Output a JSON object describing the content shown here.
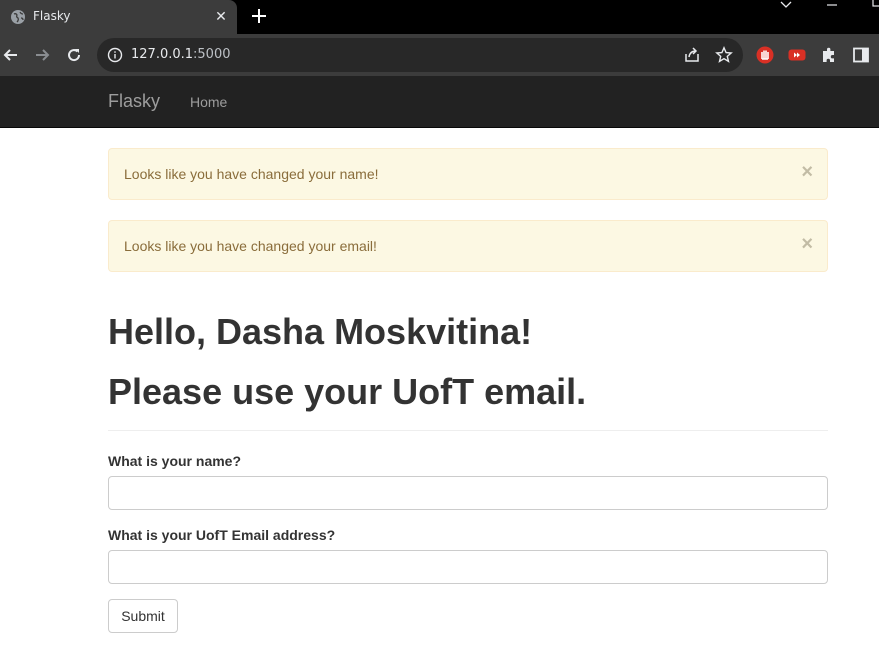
{
  "browser": {
    "tab_title": "Flasky",
    "url_host": "127.0.0.1",
    "url_port": ":5000",
    "icons": [
      "globe-icon",
      "close-icon",
      "plus-icon",
      "back-arrow-icon",
      "forward-arrow-icon",
      "reload-icon",
      "info-icon",
      "share-icon",
      "star-icon",
      "stop-hand-extension-icon",
      "youtube-extension-icon",
      "puzzle-icon",
      "side-panel-icon"
    ]
  },
  "navbar": {
    "brand": "Flasky",
    "home": "Home"
  },
  "alerts": [
    {
      "text": "Looks like you have changed your name!",
      "close": "×"
    },
    {
      "text": "Looks like you have changed your email!",
      "close": "×"
    }
  ],
  "page": {
    "greeting": "Hello, Dasha Moskvitina!",
    "notice": "Please use your UofT email."
  },
  "form": {
    "name_label": "What is your name?",
    "name_value": "",
    "email_label": "What is your UofT Email address?",
    "email_value": "",
    "submit_label": "Submit"
  },
  "colors": {
    "navbar_bg": "#222222",
    "alert_bg": "#fcf8e3",
    "alert_text": "#8a6d3b"
  }
}
